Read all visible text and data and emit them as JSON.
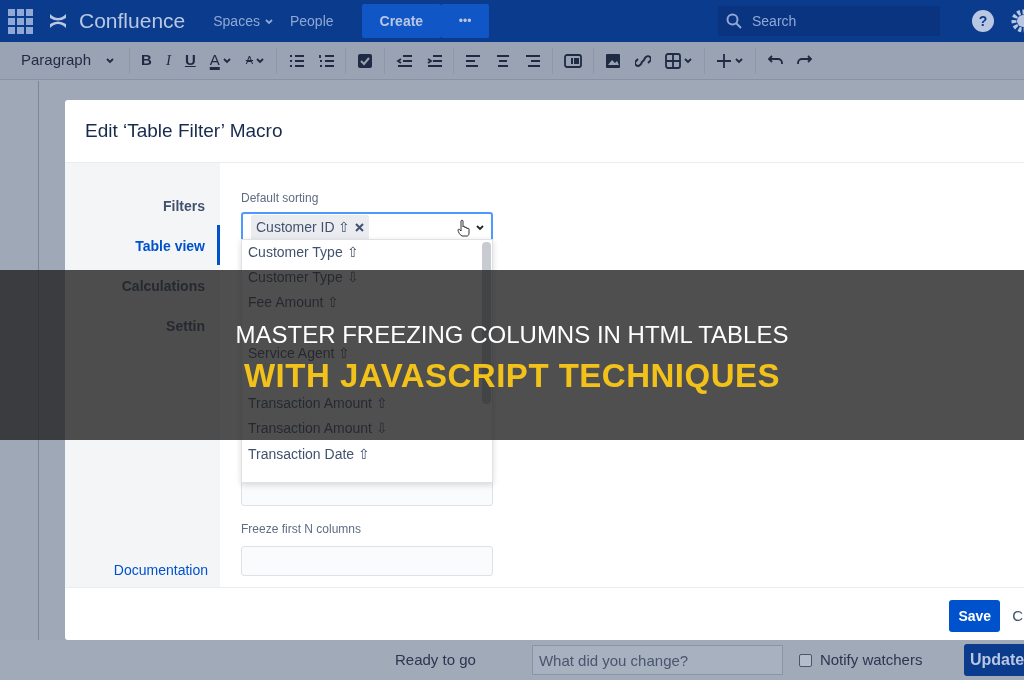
{
  "navbar": {
    "app_name": "Confluence",
    "links": [
      {
        "label": "Spaces",
        "dropdown": true
      },
      {
        "label": "People",
        "dropdown": false
      }
    ],
    "create_button": "Create",
    "more_button": "•••",
    "search": {
      "placeholder": "Search"
    },
    "help_button": "?"
  },
  "toolbar": {
    "style_select": "Paragraph",
    "tools": [
      {
        "kind": "separator"
      },
      {
        "kind": "bold",
        "label": "B",
        "dropdown": false
      },
      {
        "kind": "italic",
        "label": "I",
        "dropdown": false
      },
      {
        "kind": "underline",
        "label": "U",
        "dropdown": false
      },
      {
        "kind": "color",
        "label": "A",
        "dropdown": true
      },
      {
        "kind": "clear",
        "label": "A",
        "dropdown": true
      },
      {
        "kind": "separator"
      },
      {
        "kind": "bullets",
        "dropdown": false
      },
      {
        "kind": "numbers",
        "dropdown": false
      },
      {
        "kind": "separator"
      },
      {
        "kind": "task",
        "dropdown": false
      },
      {
        "kind": "separator"
      },
      {
        "kind": "outdent",
        "dropdown": false
      },
      {
        "kind": "indent",
        "dropdown": false
      },
      {
        "kind": "separator"
      },
      {
        "kind": "align-left",
        "dropdown": false
      },
      {
        "kind": "align-center",
        "dropdown": false
      },
      {
        "kind": "align-right",
        "dropdown": false
      },
      {
        "kind": "separator"
      },
      {
        "kind": "layout",
        "dropdown": false
      },
      {
        "kind": "separator"
      },
      {
        "kind": "image",
        "dropdown": false
      },
      {
        "kind": "link",
        "dropdown": false
      },
      {
        "kind": "table",
        "dropdown": true
      },
      {
        "kind": "separator"
      },
      {
        "kind": "insert",
        "dropdown": true
      },
      {
        "kind": "separator"
      },
      {
        "kind": "undo",
        "dropdown": false
      },
      {
        "kind": "redo",
        "dropdown": false
      }
    ]
  },
  "modal": {
    "title": "Edit ‘Table Filter’ Macro",
    "nav": [
      {
        "label": "Filters",
        "selected": false
      },
      {
        "label": "Table view",
        "selected": true
      },
      {
        "label": "Calculations",
        "selected": false
      },
      {
        "label": "Settin",
        "selected": false
      }
    ],
    "documentation_link": "Documentation",
    "default_sorting": {
      "label": "Default sorting",
      "tags": [
        "Customer ID ⇧"
      ],
      "expanded": true,
      "options": [
        {
          "kind": "option",
          "label": "Customer Type ⇧"
        },
        {
          "kind": "option",
          "label": "Customer Type ⇩"
        },
        {
          "kind": "option",
          "label": "Fee Amount ⇧"
        },
        {
          "kind": "covered"
        },
        {
          "kind": "option",
          "label": "Service Agent ⇧"
        },
        {
          "kind": "covered"
        },
        {
          "kind": "option",
          "label": "Transaction Amount ⇧"
        },
        {
          "kind": "option",
          "label": "Transaction Amount ⇩"
        },
        {
          "kind": "option",
          "label": "Transaction Date ⇧"
        }
      ]
    },
    "freeze_columns": {
      "label": "Freeze first N columns"
    },
    "save_button": "Save",
    "cancel_button": "C"
  },
  "bottom_bar": {
    "status": "Ready to go",
    "comment": {
      "placeholder": "What did you change?"
    },
    "notify": {
      "label": "Notify watchers",
      "checked": false
    },
    "update_button": "Update"
  },
  "banner": {
    "line_1": "MASTER FREEZING COLUMNS IN HTML TABLES",
    "line_2": "WITH JAVASCRIPT TECHNIQUES"
  }
}
